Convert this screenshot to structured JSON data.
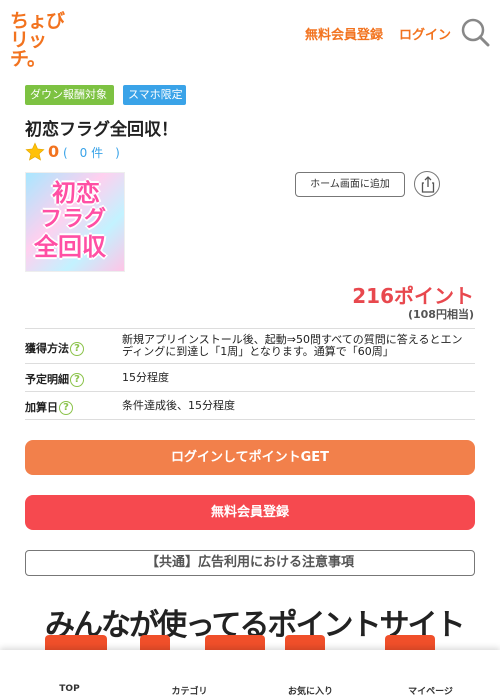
{
  "header": {
    "logo_line1": "ちょび",
    "logo_line2": "リッチ。",
    "register_label": "無料会員登録",
    "login_label": "ログイン",
    "search_icon": "search-icon",
    "brand_color": "#f2731f"
  },
  "badges": [
    {
      "label": "ダウン報酬対象",
      "color": "#7dc242"
    },
    {
      "label": "スマホ限定",
      "color": "#3aa3e8"
    }
  ],
  "offer": {
    "title": "初恋フラグ全回収！",
    "rating_score": "0",
    "rating_count": "(　0 件　)",
    "icon_text": [
      "初恋",
      "フラグ",
      "全回収"
    ],
    "home_button_label": "ホーム画面に追加",
    "share_icon": "share-icon",
    "points": "216ポイント",
    "yen_equivalent": "(108円相当)"
  },
  "info": [
    {
      "key": "獲得方法",
      "value": "新規アプリインストール後、起動⇒50問すべての質問に答えるとエンディングに到達し「1周」となります。通算で「60周」"
    },
    {
      "key": "予定明細",
      "value": "15分程度"
    },
    {
      "key": "加算日",
      "value": "条件達成後、15分程度"
    }
  ],
  "buttons": {
    "login_get": "ログインしてポイントGET",
    "register": "無料会員登録",
    "notice": "【共通】広告利用における注意事項"
  },
  "banner": {
    "text": "みんなが使ってるポイントサイト"
  },
  "bottom_nav": [
    {
      "label": "TOP",
      "icon": "home-icon"
    },
    {
      "label": "カテゴリ",
      "icon": "category-icon"
    },
    {
      "label": "お気に入り",
      "icon": "favorite-icon"
    },
    {
      "label": "マイページ",
      "icon": "user-icon"
    }
  ],
  "colors": {
    "accent": "#f2731f",
    "points_red": "#e8484e",
    "login_button": "#f2804b",
    "register_button": "#f6494f"
  }
}
